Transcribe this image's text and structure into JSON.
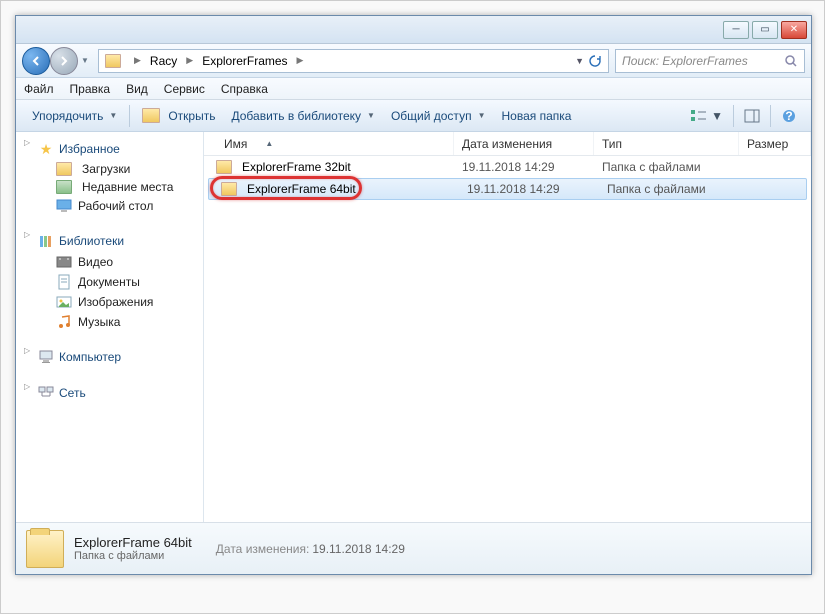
{
  "titlebar": {},
  "breadcrumbs": {
    "item0": "Racy",
    "item1": "ExplorerFrames"
  },
  "search": {
    "placeholder": "Поиск: ExplorerFrames"
  },
  "menu": {
    "file": "Файл",
    "edit": "Правка",
    "view": "Вид",
    "tools": "Сервис",
    "help": "Справка"
  },
  "toolbar": {
    "organize": "Упорядочить",
    "open": "Открыть",
    "library": "Добавить в библиотеку",
    "share": "Общий доступ",
    "newfolder": "Новая папка"
  },
  "sidebar": {
    "favorites": "Избранное",
    "fav_items": {
      "downloads": "Загрузки",
      "recent": "Недавние места",
      "desktop": "Рабочий стол"
    },
    "libraries": "Библиотеки",
    "lib_items": {
      "video": "Видео",
      "docs": "Документы",
      "images": "Изображения",
      "music": "Музыка"
    },
    "computer": "Компьютер",
    "network": "Сеть"
  },
  "columns": {
    "name": "Имя",
    "date": "Дата изменения",
    "type": "Тип",
    "size": "Размер"
  },
  "files": [
    {
      "name": "ExplorerFrame 32bit",
      "date": "19.11.2018 14:29",
      "type": "Папка с файлами"
    },
    {
      "name": "ExplorerFrame 64bit",
      "date": "19.11.2018 14:29",
      "type": "Папка с файлами"
    }
  ],
  "details": {
    "title": "ExplorerFrame 64bit",
    "subtitle": "Папка с файлами",
    "date_label": "Дата изменения:",
    "date_value": "19.11.2018 14:29"
  }
}
